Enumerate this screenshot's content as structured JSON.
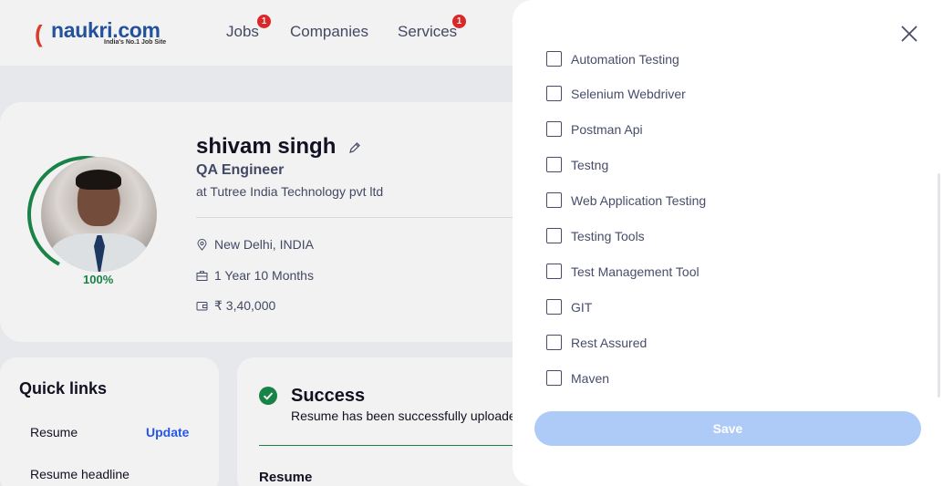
{
  "header": {
    "logo_text": "naukri.com",
    "logo_tagline": "India's No.1 Job Site",
    "nav": [
      {
        "label": "Jobs",
        "badge": "1"
      },
      {
        "label": "Companies",
        "badge": ""
      },
      {
        "label": "Services",
        "badge": "1"
      }
    ]
  },
  "profile": {
    "name": "shivam singh",
    "designation": "QA Engineer",
    "company": "at Tutree India Technology pvt ltd",
    "completion": "100%",
    "completion_fraction": 1.0,
    "location": "New Delhi, INDIA",
    "experience": "1 Year 10 Months",
    "salary": "₹ 3,40,000"
  },
  "quick_links": {
    "title": "Quick links",
    "items": [
      {
        "label": "Resume",
        "action": "Update"
      },
      {
        "label": "Resume headline",
        "action": ""
      }
    ]
  },
  "success": {
    "title": "Success",
    "message": "Resume has been successfully uploaded",
    "section_heading": "Resume"
  },
  "drawer": {
    "skills": [
      "Automation Testing",
      "Selenium Webdriver",
      "Postman Api",
      "Testng",
      "Web Application Testing",
      "Testing Tools",
      "Test Management Tool",
      "GIT",
      "Rest Assured",
      "Maven"
    ],
    "save_label": "Save"
  },
  "colors": {
    "brand_blue": "#275df5",
    "success_green": "#1a8a4b",
    "badge_red": "#e72a2a",
    "save_disabled": "#aecbf8"
  }
}
